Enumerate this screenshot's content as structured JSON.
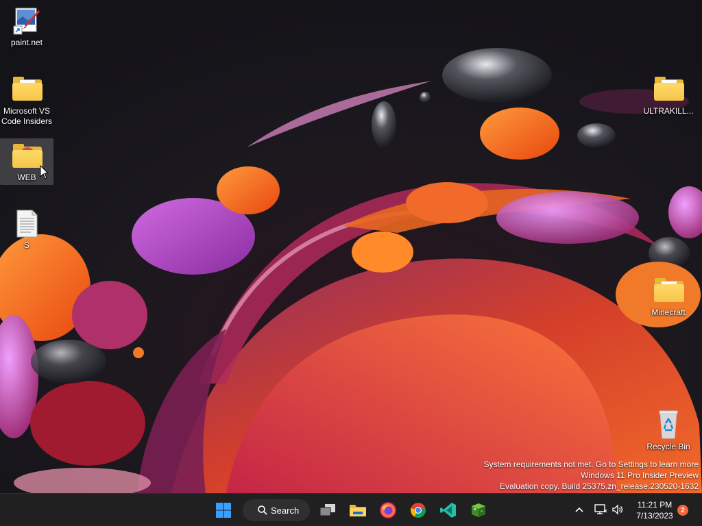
{
  "desktop": {
    "icons": [
      {
        "label": "paint.net"
      },
      {
        "label": "Microsoft VS Code Insiders"
      },
      {
        "label": "WEB"
      },
      {
        "label": "S"
      },
      {
        "label": "ULTRAKILL..."
      },
      {
        "label": "Minecraft"
      },
      {
        "label": "Recycle Bin"
      }
    ]
  },
  "watermark": {
    "line1": "System requirements not met. Go to Settings to learn more",
    "line2": "Windows 11 Pro Insider Preview",
    "line3": "Evaluation copy. Build 25375.zn_release.230520-1632"
  },
  "taskbar": {
    "search_label": "Search",
    "apps": [
      "start-icon",
      "task-view-icon",
      "file-explorer-icon",
      "firefox-icon",
      "chrome-icon",
      "vscode-insiders-icon",
      "minecraft-icon"
    ],
    "tray": [
      "chevron-up-icon",
      "network-icon",
      "volume-icon"
    ],
    "clock_time": "11:21 PM",
    "clock_date": "7/13/2023",
    "notification_count": "2"
  },
  "colors": {
    "taskbar": "#202020",
    "folder": "#f5c54a",
    "badge": "#f0643f",
    "start_blue": "#3aa0ff"
  }
}
